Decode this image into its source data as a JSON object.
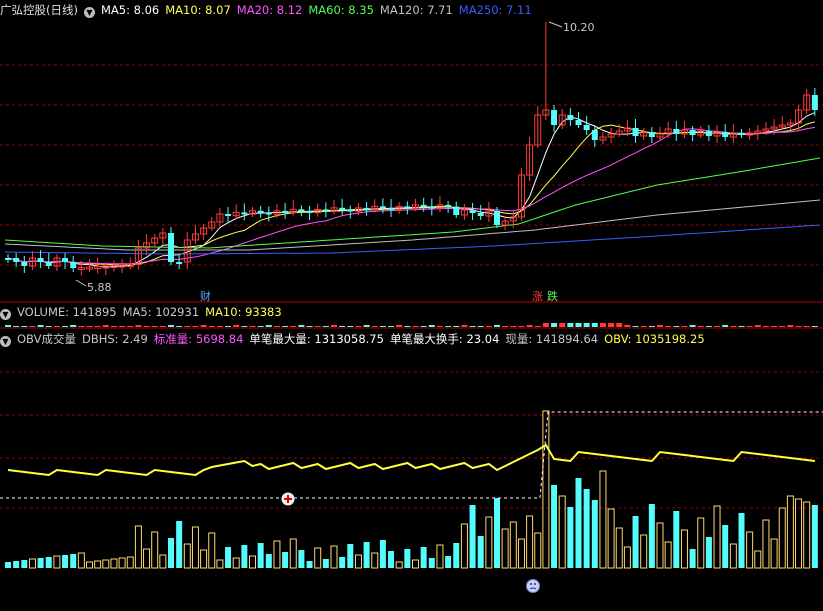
{
  "colors": {
    "up": "#ff3c3c",
    "down": "#54fcfc",
    "ma5": "#ffffff",
    "ma10": "#ffff54",
    "ma20": "#ff54ff",
    "ma60": "#54fc54",
    "ma120": "#c0c0c0",
    "ma250": "#3c5cff",
    "grid": "#9b0000",
    "obv": "#ffff3c",
    "volbar_up": "#ffd870",
    "volbar_down": "#54fcfc"
  },
  "price_panel": {
    "title": "广弘控股(日线)",
    "indicators": [
      {
        "label": "MA5: 8.06",
        "color": "#ffffff"
      },
      {
        "label": "MA10: 8.07",
        "color": "#ffff54"
      },
      {
        "label": "MA20: 8.12",
        "color": "#ff54ff"
      },
      {
        "label": "MA60: 8.35",
        "color": "#54fc54"
      },
      {
        "label": "MA120: 7.71",
        "color": "#c0c0c0"
      },
      {
        "label": "MA250: 7.11",
        "color": "#3c5cff"
      }
    ],
    "high_label": "10.20",
    "low_label": "5.88",
    "markers": [
      {
        "text": "财",
        "color": "#54a8ff"
      },
      {
        "text": "涨",
        "color": "#ff3c3c"
      },
      {
        "text": "跌",
        "color": "#54fc54"
      }
    ]
  },
  "volume_panel": {
    "indicators": [
      {
        "label": "VOLUME: 141895",
        "color": "#c8c8c8"
      },
      {
        "label": "MA5: 102931",
        "color": "#c8c8c8"
      },
      {
        "label": "MA10: 93383",
        "color": "#ffff54"
      }
    ]
  },
  "obv_panel": {
    "indicators": [
      {
        "label": "OBV成交量",
        "color": "#c8c8c8"
      },
      {
        "label": "DBHS: 2.49",
        "color": "#c8c8c8"
      },
      {
        "label": "标准量: 5698.84",
        "color": "#ff54ff"
      },
      {
        "label": "单笔最大量: 1313058.75",
        "color": "#ffffff"
      },
      {
        "label": "单笔最大换手: 23.04",
        "color": "#ffffff"
      },
      {
        "label": "现量: 141894.64",
        "color": "#c8c8c8"
      },
      {
        "label": "OBV: 1035198.25",
        "color": "#ffff54"
      }
    ]
  }
}
